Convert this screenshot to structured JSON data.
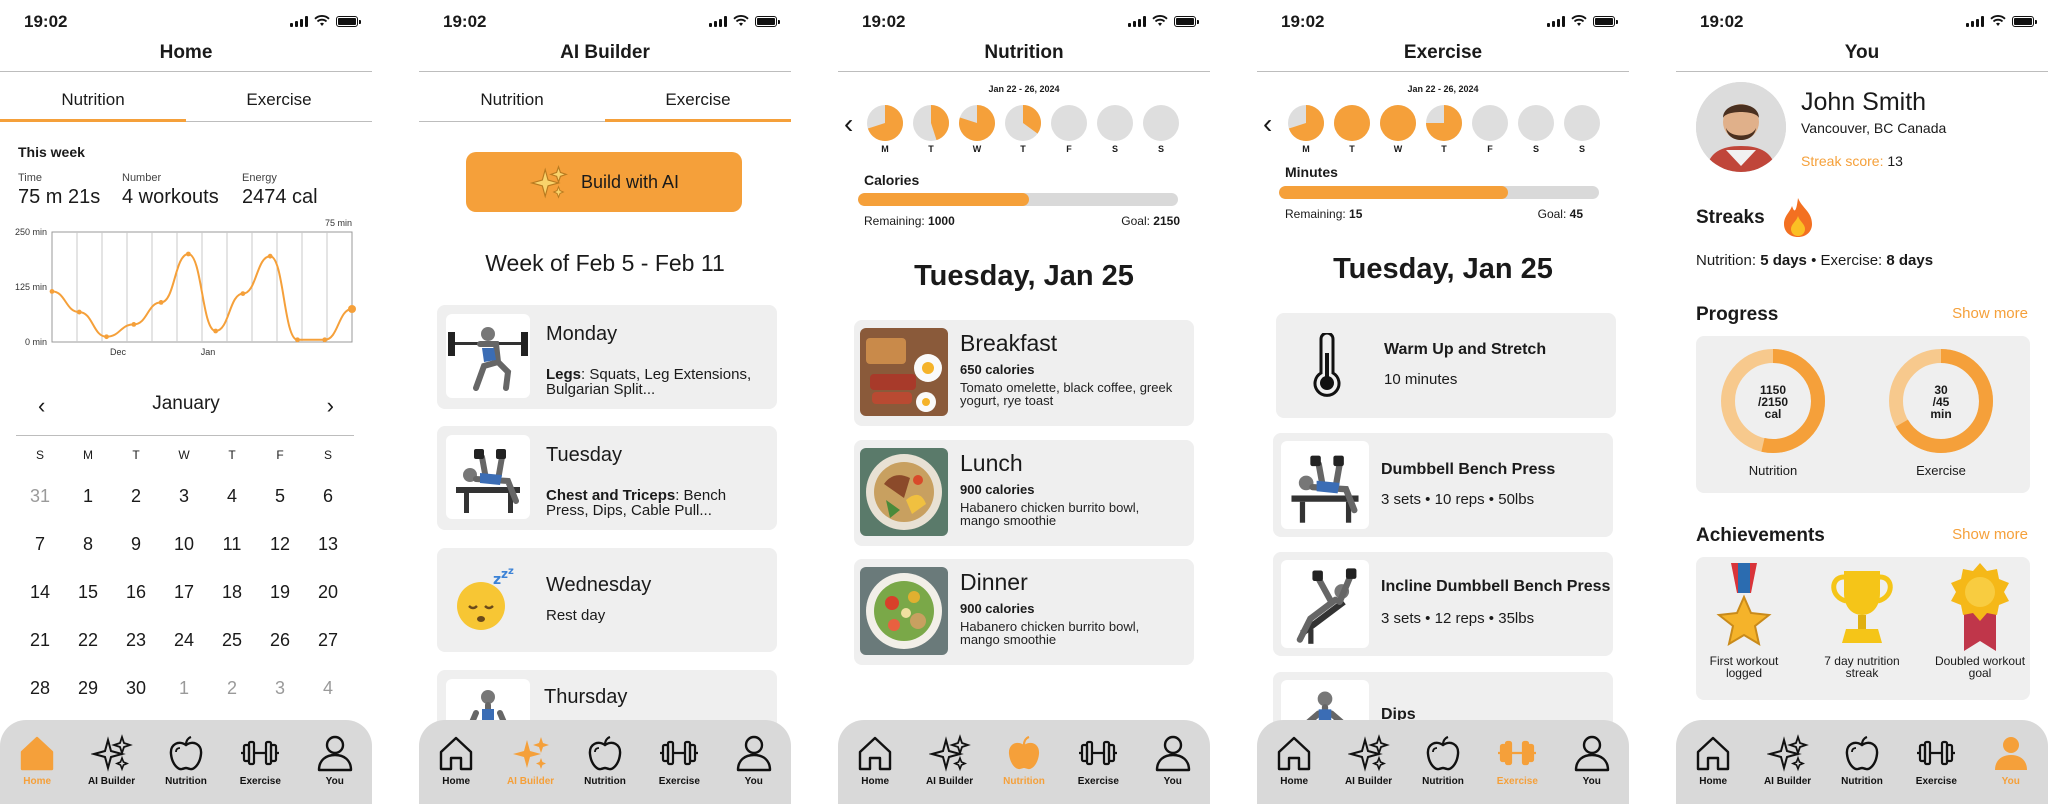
{
  "status_time": "19:02",
  "nav": [
    "Home",
    "AI Builder",
    "Nutrition",
    "Exercise",
    "You"
  ],
  "colors": {
    "accent": "#f5a03a",
    "accent_light": "#f7c98d",
    "track": "#d9d9d9",
    "card": "#efefef"
  },
  "home": {
    "title": "Home",
    "tabs": [
      "Nutrition",
      "Exercise"
    ],
    "active_tab": "Nutrition",
    "this_week": "This week",
    "stats": [
      {
        "label": "Time",
        "value": "75 m 21s"
      },
      {
        "label": "Number",
        "value": "4 workouts"
      },
      {
        "label": "Energy",
        "value": "2474 cal"
      }
    ],
    "chart_data": {
      "type": "line",
      "title": "",
      "x_tick_labels": [
        "Dec",
        "Jan"
      ],
      "y_tick_labels": [
        "250 min",
        "125 min",
        "0 min"
      ],
      "ylim": [
        0,
        250
      ],
      "end_label": "75 min",
      "grid": true,
      "series": [
        {
          "values": [
            115,
            68,
            12,
            40,
            90,
            200,
            25,
            110,
            195,
            5,
            5,
            75
          ]
        }
      ]
    },
    "calendar": {
      "month": "January",
      "prev": "‹",
      "next": "›",
      "weekdays": [
        "S",
        "M",
        "T",
        "W",
        "T",
        "F",
        "S"
      ],
      "days": [
        {
          "d": "31",
          "other": true
        },
        {
          "d": "1"
        },
        {
          "d": "2"
        },
        {
          "d": "3"
        },
        {
          "d": "4"
        },
        {
          "d": "5"
        },
        {
          "d": "6"
        },
        {
          "d": "7"
        },
        {
          "d": "8"
        },
        {
          "d": "9"
        },
        {
          "d": "10"
        },
        {
          "d": "11"
        },
        {
          "d": "12"
        },
        {
          "d": "13"
        },
        {
          "d": "14"
        },
        {
          "d": "15"
        },
        {
          "d": "16"
        },
        {
          "d": "17"
        },
        {
          "d": "18"
        },
        {
          "d": "19"
        },
        {
          "d": "20"
        },
        {
          "d": "21"
        },
        {
          "d": "22"
        },
        {
          "d": "23"
        },
        {
          "d": "24"
        },
        {
          "d": "25"
        },
        {
          "d": "26"
        },
        {
          "d": "27"
        },
        {
          "d": "28"
        },
        {
          "d": "29"
        },
        {
          "d": "30"
        },
        {
          "d": "1",
          "other": true
        },
        {
          "d": "2",
          "other": true
        },
        {
          "d": "3",
          "other": true
        },
        {
          "d": "4",
          "other": true
        }
      ]
    }
  },
  "ai": {
    "title": "AI Builder",
    "tabs": [
      "Nutrition",
      "Exercise"
    ],
    "active_tab": "Exercise",
    "build_button": "Build with AI",
    "week": "Week of Feb 5 - Feb 11",
    "days": [
      {
        "day": "Monday",
        "bold": "Legs",
        "rest": ": Squats, Leg Extensions, Bulgarian Split...",
        "icon": "squat-exercise-icon"
      },
      {
        "day": "Tuesday",
        "bold": "Chest and Triceps",
        "rest": ": Bench Press, Dips, Cable Pull...",
        "icon": "bench-press-icon"
      },
      {
        "day": "Wednesday",
        "bold": "",
        "rest": "Rest day",
        "icon": "sleeping-face-icon"
      },
      {
        "day": "Thursday",
        "bold": "",
        "rest": "",
        "icon": "curl-exercise-icon"
      }
    ]
  },
  "nutrition": {
    "title": "Nutrition",
    "range": "Jan 22 - 26, 2024",
    "days": [
      {
        "l": "M",
        "f": 0.7
      },
      {
        "l": "T",
        "f": 0.45
      },
      {
        "l": "W",
        "f": 0.8
      },
      {
        "l": "T",
        "f": 0.35
      },
      {
        "l": "F",
        "f": 0
      },
      {
        "l": "S",
        "f": 0
      },
      {
        "l": "S",
        "f": 0
      }
    ],
    "bar_label": "Calories",
    "bar_fraction": 0.535,
    "remaining_label": "Remaining:",
    "remaining": "1000",
    "goal_label": "Goal:",
    "goal": "2150",
    "date": "Tuesday, Jan 25",
    "meals": [
      {
        "name": "Breakfast",
        "cal": "650 calories",
        "desc": "Tomato omelette, black coffee, greek yogurt, rye toast"
      },
      {
        "name": "Lunch",
        "cal": "900 calories",
        "desc": "Habanero chicken burrito bowl, mango smoothie"
      },
      {
        "name": "Dinner",
        "cal": "900 calories",
        "desc": "Habanero chicken burrito bowl, mango smoothie"
      }
    ]
  },
  "exercise": {
    "title": "Exercise",
    "range": "Jan 22 - 26, 2024",
    "days": [
      {
        "l": "M",
        "f": 0.7
      },
      {
        "l": "T",
        "f": 1
      },
      {
        "l": "W",
        "f": 1
      },
      {
        "l": "T",
        "f": 0.75
      },
      {
        "l": "F",
        "f": 0
      },
      {
        "l": "S",
        "f": 0
      },
      {
        "l": "S",
        "f": 0
      }
    ],
    "bar_label": "Minutes",
    "bar_fraction": 0.715,
    "remaining_label": "Remaining:",
    "remaining": "15",
    "goal_label": "Goal:",
    "goal": "45",
    "date": "Tuesday, Jan 25",
    "items": [
      {
        "name": "Warm Up and Stretch",
        "sub": "10 minutes"
      },
      {
        "name": "Dumbbell Bench Press",
        "sub": "3 sets • 10 reps • 50lbs"
      },
      {
        "name": "Incline Dumbbell Bench Press",
        "sub": "3 sets • 12 reps • 35lbs"
      },
      {
        "name": "Dips",
        "sub": ""
      }
    ]
  },
  "you": {
    "title": "You",
    "name": "John Smith",
    "location": "Vancouver, BC Canada",
    "streak_label": "Streak score:",
    "streak_score": "13",
    "streaks_title": "Streaks",
    "nutrition_label": "Nutrition:",
    "nutrition_days": "5 days",
    "separator": "•",
    "exercise_label": "Exercise:",
    "exercise_days": "8 days",
    "progress_title": "Progress",
    "show_more": "Show more",
    "donuts": [
      {
        "l1": "1150",
        "l2": "/2150",
        "l3": "cal",
        "label": "Nutrition",
        "f": 0.535
      },
      {
        "l1": "30",
        "l2": "/45",
        "l3": "min",
        "label": "Exercise",
        "f": 0.667
      }
    ],
    "achievements_title": "Achievements",
    "achievements": [
      {
        "label": "First workout logged",
        "icon": "medal-icon"
      },
      {
        "label": "7 day nutrition streak",
        "icon": "trophy-icon"
      },
      {
        "label": "Doubled workout goal",
        "icon": "ribbon-badge-icon"
      }
    ]
  }
}
